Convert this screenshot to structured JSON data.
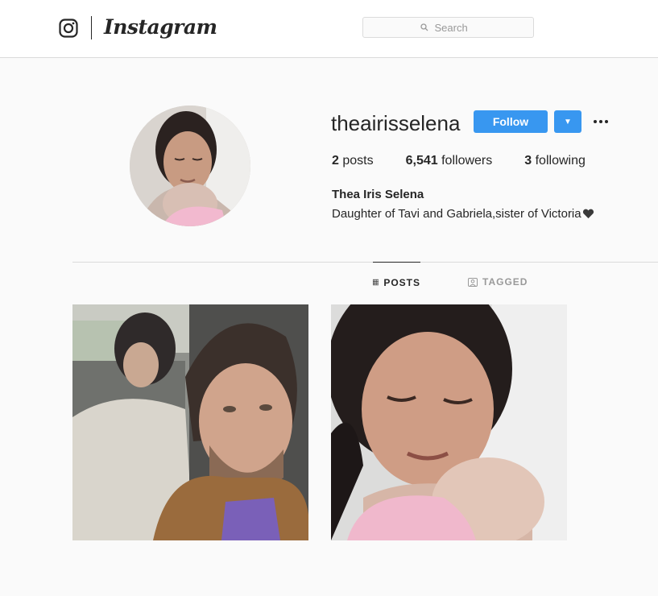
{
  "header": {
    "brand_name": "Instagram",
    "logo_icon": "instagram-camera-icon",
    "search": {
      "placeholder": "Search",
      "icon": "search-icon"
    }
  },
  "profile": {
    "username": "theairisselena",
    "follow_label": "Follow",
    "dropdown_icon": "caret-down-icon",
    "more_icon": "ellipsis-icon",
    "stats": {
      "posts_count": "2",
      "posts_label": "posts",
      "followers_count": "6,541",
      "followers_label": "followers",
      "following_count": "3",
      "following_label": "following"
    },
    "full_name": "Thea Iris Selena",
    "bio": "Daughter of Tavi and Gabriela,sister of Victoria",
    "bio_emoji_icon": "black-heart-icon"
  },
  "tabs": [
    {
      "label": "POSTS",
      "icon": "grid-icon",
      "active": true
    },
    {
      "label": "TAGGED",
      "icon": "tagged-icon",
      "active": false
    }
  ],
  "posts": [
    {
      "description_icon": "photo-selfie-car"
    },
    {
      "description_icon": "photo-mother-newborn"
    }
  ],
  "colors": {
    "accent": "#3897f0",
    "text": "#262626",
    "muted": "#999999",
    "border": "#dbdbdb",
    "background": "#fafafa"
  }
}
